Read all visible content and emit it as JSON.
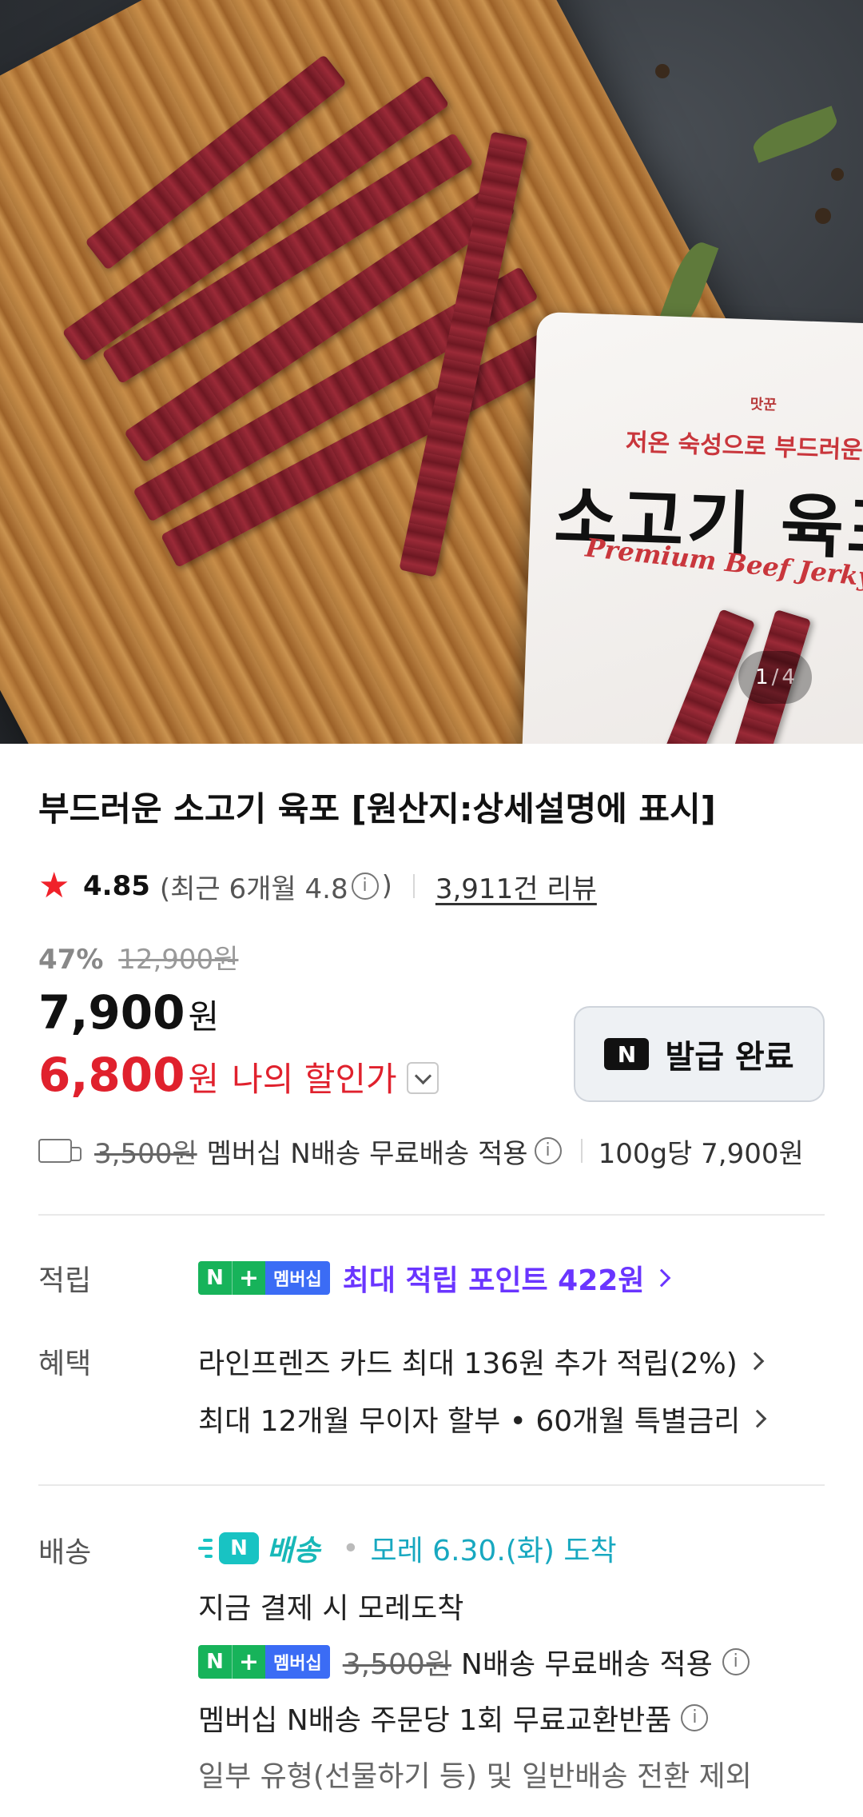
{
  "hero": {
    "pouch_brand": "맛꾼",
    "pouch_tagline": "저온 숙성으로 부드러운",
    "pouch_title": "소고기 육포",
    "pouch_english": "Premium Beef Jerky",
    "pager_current": "1",
    "pager_sep": "/",
    "pager_total": "4"
  },
  "product": {
    "title": "부드러운 소고기 육포 [원산지:상세설명에 표시]",
    "rating": "4.85",
    "recent_rating_label": "(최근 6개월 4.8",
    "recent_rating_close": ")",
    "reviews": "3,911건 리뷰",
    "discount_pct": "47%",
    "original_price": "12,900원",
    "price": "7,900",
    "price_unit": "원",
    "my_price": "6,800",
    "my_price_unit": "원",
    "my_price_label": "나의 할인가",
    "coupon_button": "발급 완료",
    "coupon_icon_text": "N",
    "shipping_fee": "3,500원",
    "shipping_note": "멤버십 N배송 무료배송 적용",
    "unit_price": "100g당 7,900원"
  },
  "points": {
    "label": "적립",
    "badge_n": "N",
    "badge_plus": "+",
    "badge_member": "멤버십",
    "text": "최대 적립 포인트 422원"
  },
  "benefits": {
    "label": "혜택",
    "line1": "라인프렌즈 카드 최대 136원 추가 적립(2%)",
    "line2": "최대 12개월 무이자 할부 • 60개월 특별금리"
  },
  "delivery": {
    "label": "배송",
    "logo_n": "N",
    "logo_text": "배송",
    "arrival": "모레 6.30.(화) 도착",
    "line2": "지금 결제 시 모레도착",
    "fee": "3,500원",
    "fee_note": "N배송 무료배송 적용",
    "line4": "멤버십 N배송 주문당 1회 무료교환반품",
    "line5": "일부 유형(선물하기 등) 및 일반배송 전환 제외"
  },
  "colors": {
    "accent_red": "#e0212d",
    "member_green": "#17b35a",
    "member_blue": "#3b6cf5",
    "points_purple": "#6a35ff",
    "nship_teal": "#18c3c3"
  }
}
